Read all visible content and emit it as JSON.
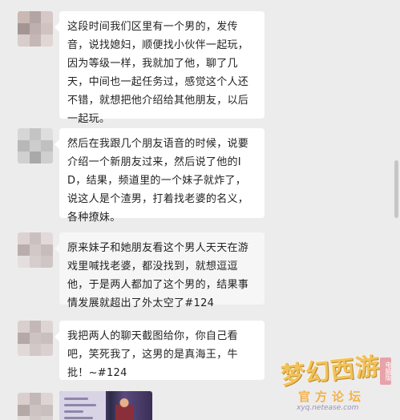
{
  "messages": [
    {
      "text": "这段时间我们区里有一个男的，发传音，说找媳妇，顺便找小伙伴一起玩，因为等级一样，我就加了他，聊了几天，中间也一起任务过，感觉这个人还不错，就想把他介绍给其他朋友，以后一起玩。"
    },
    {
      "text": "然后在我跟几个朋友语音的时候，说要介绍一个新朋友过来，然后说了他的ID，结果，频道里的一个妹子就炸了，说这人是个渣男，打着找老婆的名义，各种撩妹。"
    },
    {
      "text": "原来妹子和她朋友看这个男人天天在游戏里喊找老婆，都没找到，就想逗逗他，于是两人都加了这个男的，结果事情发展就超出了外太空了#124"
    },
    {
      "text": "我把两人的聊天截图给你，你自己看吧，笑死我了，这男的是真海王，牛批！~#124"
    }
  ],
  "watermark": {
    "logo": "梦幻西游",
    "sub": "官方论坛",
    "url": "xyq.netease.com",
    "badge": "电脑版"
  },
  "colors": {
    "background": "#ececec",
    "bubble": "#ffffff",
    "scroll_thumb": "#c6c6c6"
  }
}
